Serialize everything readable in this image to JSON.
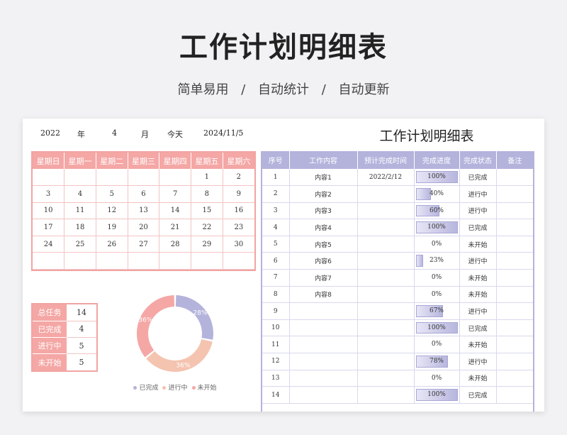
{
  "header": {
    "title": "工作计划明细表",
    "subtitle": [
      "简单易用",
      "/",
      "自动统计",
      "/",
      "自动更新"
    ]
  },
  "info": {
    "year": "2022",
    "year_label": "年",
    "month": "4",
    "month_label": "月",
    "today_label": "今天",
    "today": "2024/11/5"
  },
  "sheet_title": "工作计划明细表",
  "calendar": {
    "weekdays": [
      "星期日",
      "星期一",
      "星期二",
      "星期三",
      "星期四",
      "星期五",
      "星期六"
    ],
    "weeks": [
      [
        "",
        "",
        "",
        "",
        "",
        "1",
        "2"
      ],
      [
        "3",
        "4",
        "5",
        "6",
        "7",
        "8",
        "9"
      ],
      [
        "10",
        "11",
        "12",
        "13",
        "14",
        "15",
        "16"
      ],
      [
        "17",
        "18",
        "19",
        "20",
        "21",
        "22",
        "23"
      ],
      [
        "24",
        "25",
        "26",
        "27",
        "28",
        "29",
        "30"
      ],
      [
        "",
        "",
        "",
        "",
        "",
        "",
        ""
      ]
    ]
  },
  "stats": [
    {
      "label": "总任务",
      "value": "14"
    },
    {
      "label": "已完成",
      "value": "4"
    },
    {
      "label": "进行中",
      "value": "5"
    },
    {
      "label": "未开始",
      "value": "5"
    }
  ],
  "chart_data": {
    "type": "pie",
    "donut": true,
    "categories": [
      "已完成",
      "进行中",
      "未开始"
    ],
    "values": [
      28,
      36,
      36
    ],
    "labels": [
      "28%",
      "36%",
      "36%"
    ],
    "colors": [
      "#b4b3dc",
      "#f4c4b0",
      "#f4a7a5"
    ],
    "legend": "bottom"
  },
  "tasks": {
    "headers": [
      "序号",
      "工作内容",
      "预计完成时间",
      "完成进度",
      "完成状态",
      "备注"
    ],
    "rows": [
      {
        "no": "1",
        "content": "内容1",
        "date": "2022/2/12",
        "progress": 1.0,
        "progress_label": "100%",
        "status": "已完成",
        "note": ""
      },
      {
        "no": "2",
        "content": "内容2",
        "date": "",
        "progress": 0.4,
        "progress_label": "40%",
        "status": "进行中",
        "note": ""
      },
      {
        "no": "3",
        "content": "内容3",
        "date": "",
        "progress": 0.6,
        "progress_label": "60%",
        "status": "进行中",
        "note": ""
      },
      {
        "no": "4",
        "content": "内容4",
        "date": "",
        "progress": 1.0,
        "progress_label": "100%",
        "status": "已完成",
        "note": ""
      },
      {
        "no": "5",
        "content": "内容5",
        "date": "",
        "progress": 0,
        "progress_label": "0%",
        "status": "未开始",
        "note": ""
      },
      {
        "no": "6",
        "content": "内容6",
        "date": "",
        "progress": 0.23,
        "progress_label": "23%",
        "status": "进行中",
        "note": ""
      },
      {
        "no": "7",
        "content": "内容7",
        "date": "",
        "progress": 0,
        "progress_label": "0%",
        "status": "未开始",
        "note": ""
      },
      {
        "no": "8",
        "content": "内容8",
        "date": "",
        "progress": 0,
        "progress_label": "0%",
        "status": "未开始",
        "note": ""
      },
      {
        "no": "9",
        "content": "",
        "date": "",
        "progress": 0.67,
        "progress_label": "67%",
        "status": "进行中",
        "note": ""
      },
      {
        "no": "10",
        "content": "",
        "date": "",
        "progress": 1.0,
        "progress_label": "100%",
        "status": "已完成",
        "note": ""
      },
      {
        "no": "11",
        "content": "",
        "date": "",
        "progress": 0,
        "progress_label": "0%",
        "status": "未开始",
        "note": ""
      },
      {
        "no": "12",
        "content": "",
        "date": "",
        "progress": 0.78,
        "progress_label": "78%",
        "status": "进行中",
        "note": ""
      },
      {
        "no": "13",
        "content": "",
        "date": "",
        "progress": 0,
        "progress_label": "0%",
        "status": "未开始",
        "note": ""
      },
      {
        "no": "14",
        "content": "",
        "date": "",
        "progress": 1.0,
        "progress_label": "100%",
        "status": "已完成",
        "note": ""
      }
    ]
  }
}
